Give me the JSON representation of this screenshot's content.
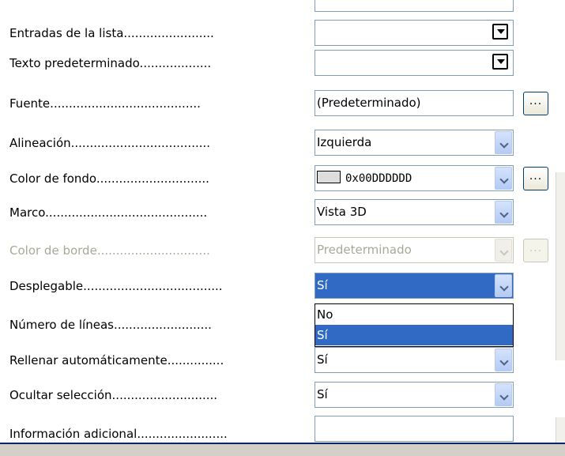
{
  "properties": [
    {
      "label": "Entradas de la lista",
      "dots": "........................",
      "value": "",
      "control": "list",
      "disabled": false
    },
    {
      "label": "Texto predeterminado",
      "dots": "...................",
      "value": "",
      "control": "list",
      "disabled": false
    },
    {
      "label": "Fuente",
      "dots": "........................................",
      "value": "(Predeterminado)",
      "control": "text-ellipsis",
      "disabled": false
    },
    {
      "label": "Alineación",
      "dots": ".....................................",
      "value": "Izquierda",
      "control": "combo",
      "disabled": false
    },
    {
      "label": "Color de fondo",
      "dots": "..............................",
      "value": "0x00DDDDDD",
      "control": "combo-ellipsis-swatch",
      "disabled": false
    },
    {
      "label": "Marco",
      "dots": "...........................................",
      "value": "Vista 3D",
      "control": "combo",
      "disabled": false
    },
    {
      "label": "Color de borde",
      "dots": "..............................",
      "value": "Predeterminado",
      "control": "combo-ellipsis",
      "disabled": true
    },
    {
      "label": "Desplegable",
      "dots": ".....................................",
      "value": "Sí",
      "control": "combo-open",
      "disabled": false
    },
    {
      "label": "Número de líneas",
      "dots": "..........................",
      "value": "",
      "control": "hidden",
      "disabled": false
    },
    {
      "label": "Rellenar automáticamente",
      "dots": "...............",
      "value": "Sí",
      "control": "combo",
      "disabled": false
    },
    {
      "label": "Ocultar selección",
      "dots": "............................",
      "value": "Sí",
      "control": "combo",
      "disabled": false
    },
    {
      "label": "Información adicional",
      "dots": "........................",
      "value": "",
      "control": "text",
      "disabled": false
    }
  ],
  "ellipsis_label": "...",
  "dropdown": {
    "options": [
      "No",
      "Sí"
    ],
    "selected_index": 1
  },
  "colors": {
    "selection": "#316ac5",
    "swatch": "#dddddd"
  }
}
